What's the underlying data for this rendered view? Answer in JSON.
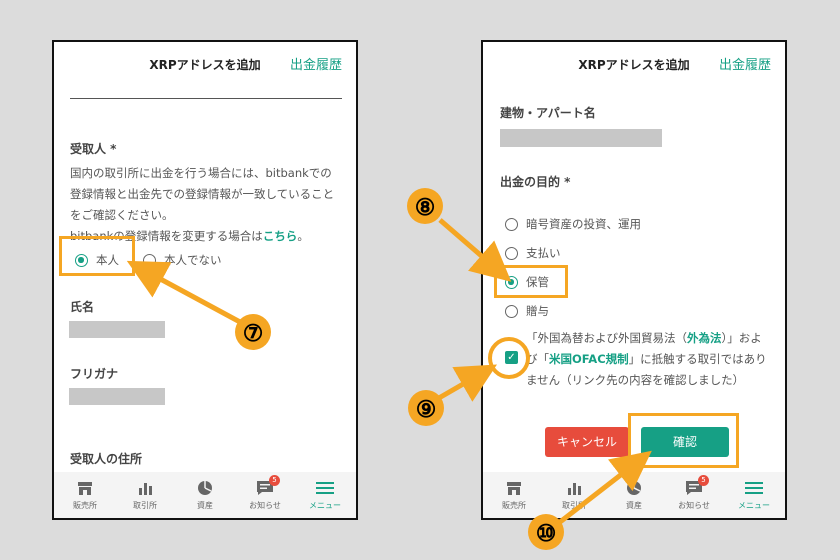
{
  "left_screen": {
    "header": {
      "title": "XRPアドレスを追加",
      "history_link": "出金履歴"
    },
    "recipient": {
      "label": "受取人 *",
      "desc1": "国内の取引所に出金を行う場合には、bitbankでの",
      "desc2": "登録情報と出金先での登録情報が一致していること",
      "desc3": "をご確認ください。",
      "desc4_prefix": "bitbankの登録情報を変更する場合は",
      "desc4_link": "こちら",
      "desc4_suffix": "。",
      "option_self": "本人",
      "option_other": "本人でない"
    },
    "name_label": "氏名",
    "kana_label": "フリガナ",
    "address_label": "受取人の住所"
  },
  "right_screen": {
    "header": {
      "title": "XRPアドレスを追加",
      "history_link": "出金履歴"
    },
    "building_label": "建物・アパート名",
    "purpose": {
      "label": "出金の目的 *",
      "options": [
        "暗号資産の投資、運用",
        "支払い",
        "保管",
        "贈与"
      ],
      "selected": "保管"
    },
    "agreement": {
      "line1_a": "「外国為替および外国貿易法（",
      "line1_link": "外為法",
      "line1_b": "）」およ",
      "line2_a": "び「",
      "line2_link": "米国OFAC規制",
      "line2_b": "」に抵触する取引ではあり",
      "line3": "ません（リンク先の内容を確認しました）",
      "checked": true
    },
    "buttons": {
      "cancel": "キャンセル",
      "confirm": "確認"
    }
  },
  "tabbar": {
    "items": [
      "販売所",
      "取引所",
      "資産",
      "お知らせ",
      "メニュー"
    ],
    "badge_count": "5"
  },
  "annotations": {
    "n7": "⑦",
    "n8": "⑧",
    "n9": "⑨",
    "n10": "⑩"
  },
  "colors": {
    "accent": "#16a085",
    "highlight": "#f5a623",
    "cancel": "#e74c3c"
  }
}
